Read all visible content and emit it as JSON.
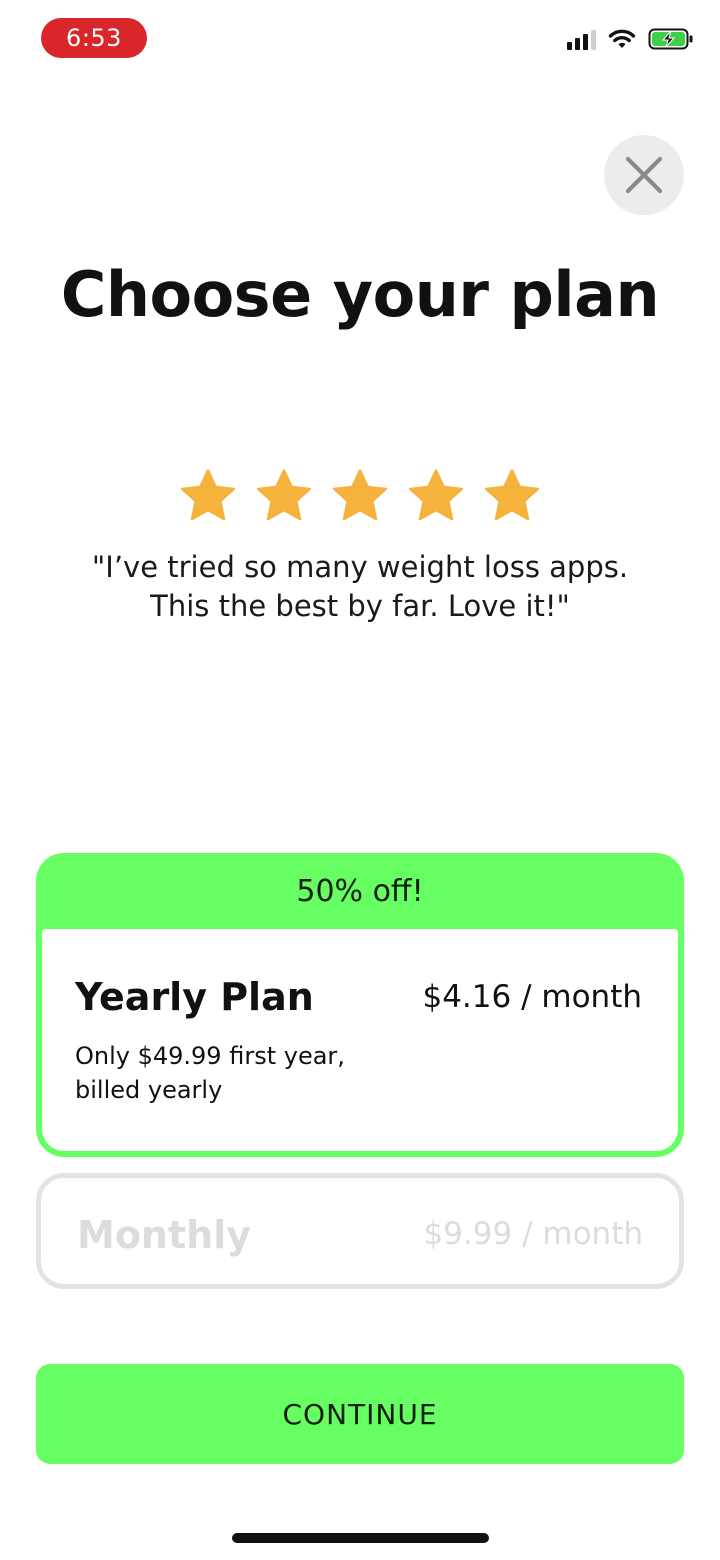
{
  "status_bar": {
    "time": "6:53",
    "icons": [
      "signal-icon",
      "wifi-icon",
      "battery-charging-icon"
    ],
    "time_pill_color": "#d9262b"
  },
  "header": {
    "close_icon": "close-icon",
    "title": "Choose your plan"
  },
  "review": {
    "rating": 5,
    "star_color": "#f5b33e",
    "quote_line1": "\"I’ve tried so many weight loss apps.",
    "quote_line2": "This the best by far. Love it!\""
  },
  "plans": {
    "yearly": {
      "badge": "50% off!",
      "name": "Yearly Plan",
      "price": "$4.16 / month",
      "description_line1": "Only $49.99 first year,",
      "description_line2": "billed yearly",
      "selected": true
    },
    "monthly": {
      "name": "Monthly",
      "price": "$9.99 / month",
      "selected": false
    }
  },
  "actions": {
    "continue_label": "CONTINUE"
  },
  "colors": {
    "accent": "#66fe62",
    "unselected_border": "#e5e3e1"
  }
}
